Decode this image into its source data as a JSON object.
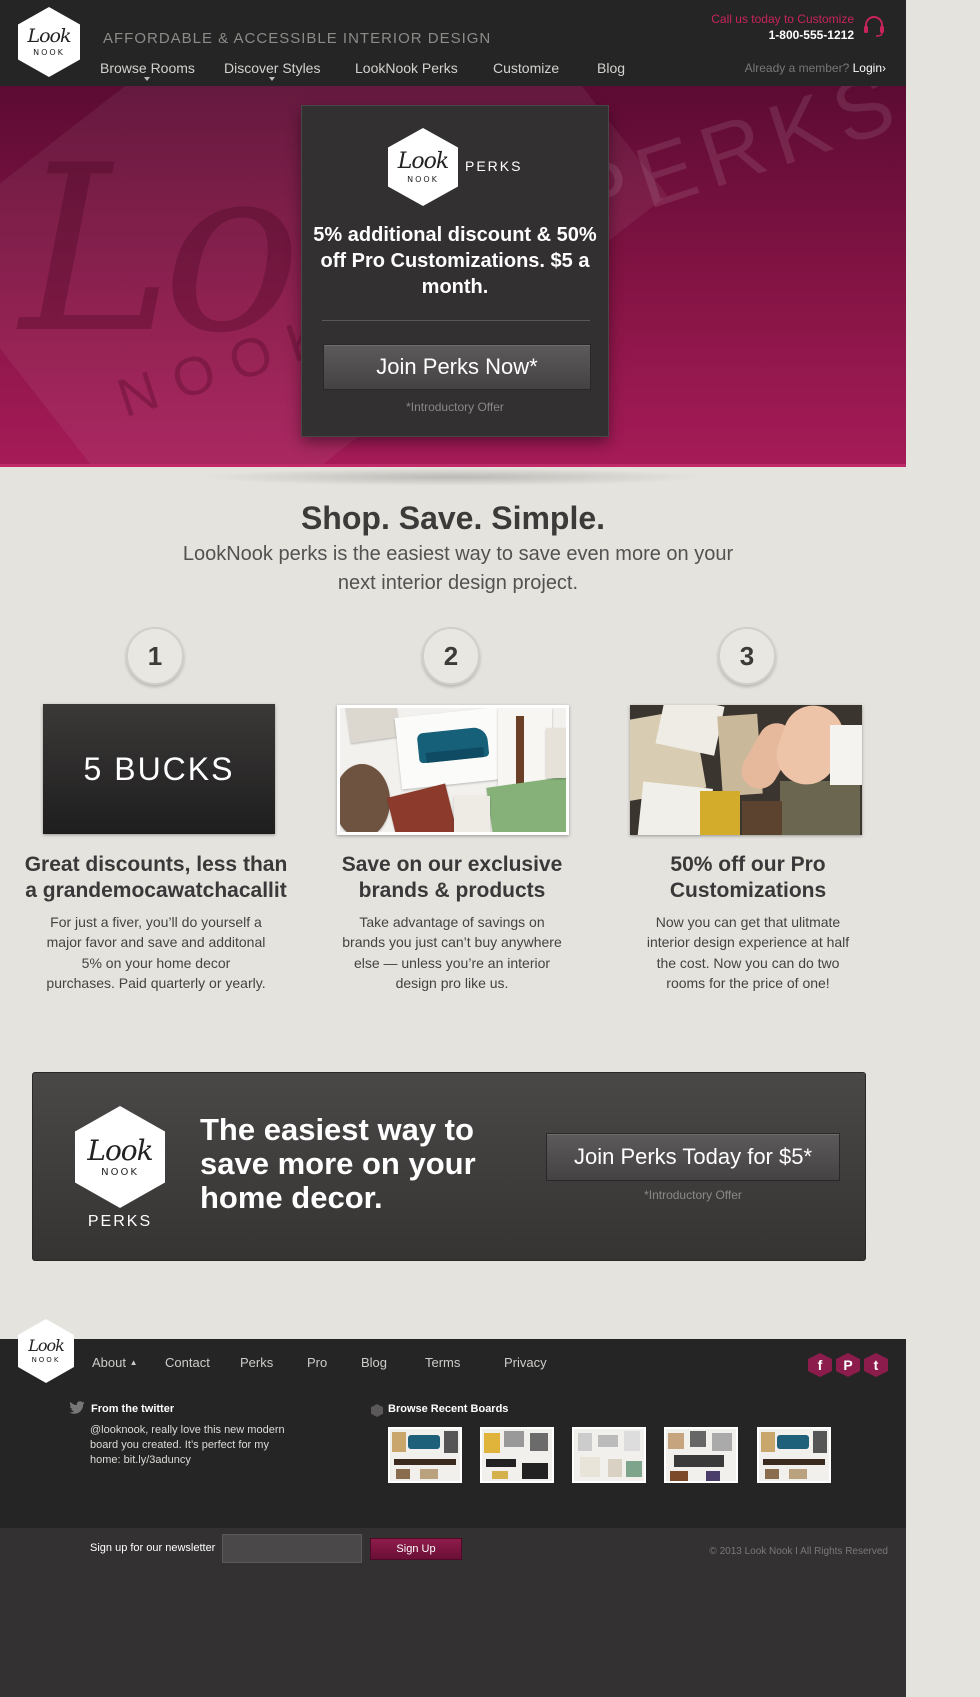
{
  "brand": {
    "logo_script": "Look",
    "logo_word": "NOOK",
    "accent_color": "#c8245b",
    "perks_color": "#8a1547"
  },
  "header": {
    "tagline": "AFFORDABLE & ACCESSIBLE INTERIOR DESIGN",
    "call_label": "Call us today to Customize",
    "phone": "1-800-555-1212",
    "member_text": "Already a member?",
    "login_label": "Login",
    "nav": [
      {
        "label": "Browse Rooms",
        "has_dropdown": true
      },
      {
        "label": "Discover Styles",
        "has_dropdown": true
      },
      {
        "label": "LookNook Perks",
        "has_dropdown": false
      },
      {
        "label": "Customize",
        "has_dropdown": false
      },
      {
        "label": "Blog",
        "has_dropdown": false
      }
    ]
  },
  "hero": {
    "bg_script": "Look",
    "bg_nook": "NOOK",
    "bg_perks": "PERKS",
    "perks_word": "PERKS",
    "headline": "5% additional discount & 50% off Pro Customizations. $5 a month.",
    "button_label": "Join Perks Now*",
    "offer_note": "*Introductory Offer"
  },
  "intro": {
    "title": "Shop. Save. Simple.",
    "subtitle": "LookNook perks is the easiest way to save even more on your next interior design project."
  },
  "steps": [
    {
      "number": "1",
      "image_text": "5 BUCKS",
      "title": "Great discounts, less than a grandemocawatchacallit",
      "body": "For just a fiver, you’ll do yourself a major favor and save and additonal 5% on your home decor purchases. Paid quarterly or yearly."
    },
    {
      "number": "2",
      "image_text": "",
      "title": "Save on our exclusive brands & products",
      "body": "Take advantage of savings on brands you just can’t buy anywhere else — unless you’re an interior design pro like us."
    },
    {
      "number": "3",
      "image_text": "",
      "title": "50% off our Pro Customizations",
      "body": "Now you can get that ulitmate interior design experience at half the cost. Now you can do two rooms for the price of one!"
    }
  ],
  "cta": {
    "perks_word": "PERKS",
    "title": "The easiest way to save more on your home decor.",
    "button_label": "Join Perks Today for $5*",
    "offer_note": "*Introductory Offer"
  },
  "footer": {
    "nav": [
      {
        "label": "About",
        "has_dropdown": true
      },
      {
        "label": "Contact",
        "has_dropdown": false
      },
      {
        "label": "Perks",
        "has_dropdown": false
      },
      {
        "label": "Pro",
        "has_dropdown": false
      },
      {
        "label": "Blog",
        "has_dropdown": false
      },
      {
        "label": "Terms",
        "has_dropdown": false
      },
      {
        "label": "Privacy",
        "has_dropdown": false
      }
    ],
    "social": [
      {
        "icon": "facebook-icon",
        "glyph": "f"
      },
      {
        "icon": "pinterest-icon",
        "glyph": "P"
      },
      {
        "icon": "twitter-icon",
        "glyph": "t"
      }
    ],
    "twitter_heading": "From the twitter",
    "tweet": "@looknook, really love this new modern board you created. It’s perfect for my home: bit.ly/3aduncy",
    "boards_heading": "Browse Recent Boards",
    "boards_count_shown": 5
  },
  "newsletter": {
    "label": "Sign up for our newsletter",
    "input_value": "",
    "button_label": "Sign Up",
    "copyright": "© 2013 Look Nook   I   All Rights Reserved"
  }
}
